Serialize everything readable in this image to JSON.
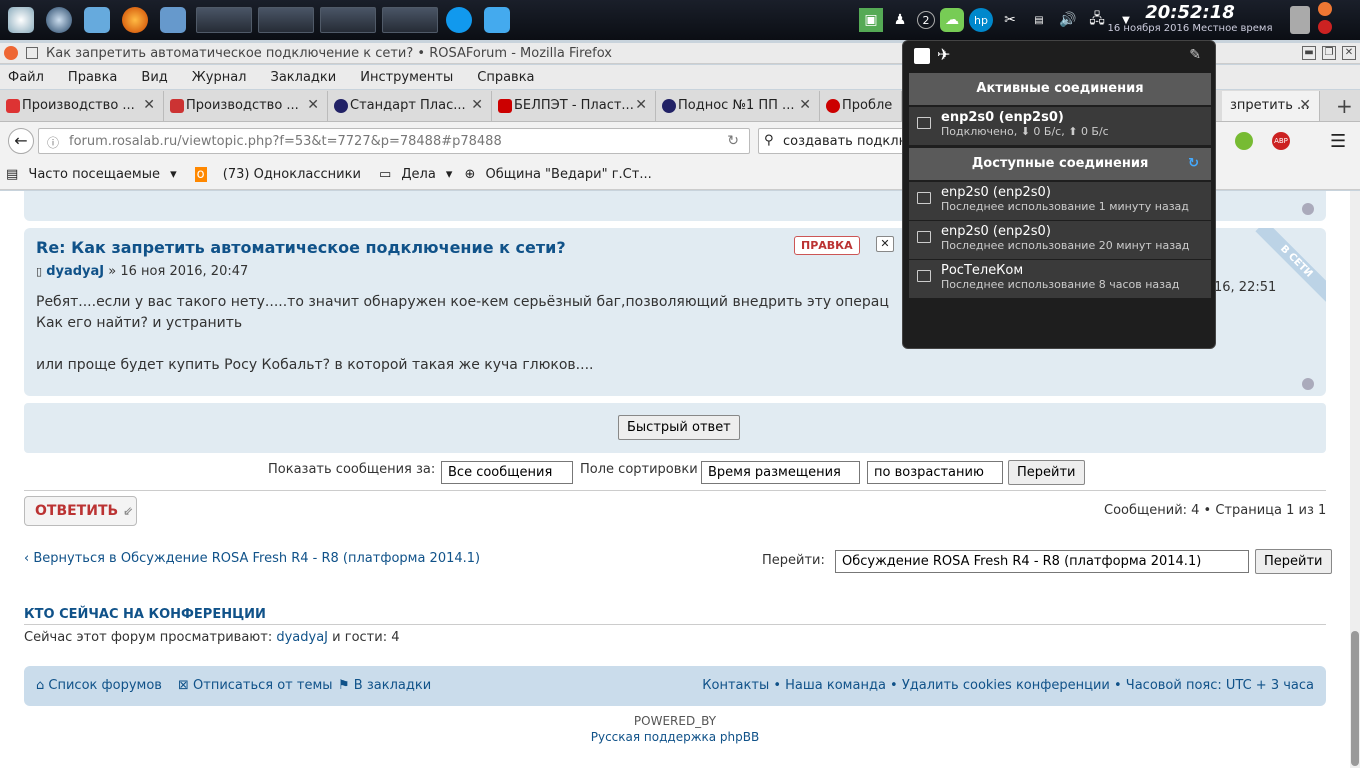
{
  "panel": {
    "time": "20:52:18",
    "date": "16 ноября 2016 Местное время",
    "tray_badge": "2"
  },
  "window": {
    "title": "Как запретить автоматическое подключение к сети? • ROSAForum - Mozilla Firefox"
  },
  "menu": [
    "Файл",
    "Правка",
    "Вид",
    "Журнал",
    "Закладки",
    "Инструменты",
    "Справка"
  ],
  "tabs": [
    {
      "label": "Производство ...",
      "color": "#d33"
    },
    {
      "label": "Производство ...",
      "color": "#c33"
    },
    {
      "label": "Стандарт Плас...",
      "color": "#226"
    },
    {
      "label": "БЕЛПЭТ - Пласт...",
      "color": "#c00"
    },
    {
      "label": "Поднос №1 ПП ...",
      "color": "#226"
    },
    {
      "label": "Пробле",
      "color": "#c00"
    },
    {
      "label": "зпретить ...",
      "color": "#888"
    }
  ],
  "nav": {
    "url": "forum.rosalab.ru/viewtopic.php?f=53&t=7727&p=78488#p78488",
    "search": "создавать подключ"
  },
  "bookmarks": [
    "Часто посещаемые",
    "(73) Одноклассники",
    "Дела",
    "Община \"Ведари\" г.Ст..."
  ],
  "post": {
    "title": "Re: Как запретить автоматическое подключение к сети?",
    "author": "dyadyaJ",
    "date": "» 16 ноя 2016, 20:47",
    "edit": "ПРАВКА",
    "online": "В СЕТИ",
    "side_date": "16, 22:51",
    "body": "Ребят....если у вас такого нету.....то значит обнаружен кое-кем серьёзный баг,позволяющий внедрить эту операц\nКак его найти? и устранить\n\nили проще будет купить Росу Кобальт? в которой такая же куча глюков...."
  },
  "quick_reply": "Быстрый ответ",
  "sort": {
    "show_label": "Показать сообщения за:",
    "show_value": "Все сообщения",
    "sort_label": "Поле сортировки",
    "sort_value": "Время размещения",
    "order_value": "по возрастанию",
    "go": "Перейти"
  },
  "reply_button": "ОТВЕТИТЬ",
  "pagination": "Сообщений: 4 • Страница 1 из 1",
  "back_link": "Вернуться в Обсуждение ROSA Fresh R4 - R8 (платформа 2014.1)",
  "jump": {
    "label": "Перейти:",
    "value": "Обсуждение ROSA Fresh R4 - R8 (платформа 2014.1)",
    "go": "Перейти"
  },
  "online": {
    "heading": "КТО СЕЙЧАС НА КОНФЕРЕНЦИИ",
    "text": "Сейчас этот форум просматривают:",
    "user": "dyadyaJ",
    "guests": "и гости: 4"
  },
  "footer": {
    "forums": "Список форумов",
    "unsub": "Отписаться от темы",
    "bookmark": "В закладки",
    "right": "Контакты • Наша команда • Удалить cookies конференции • Часовой пояс: UTC + 3 часа",
    "powered": "POWERED_BY",
    "support": "Русская поддержка phpBB"
  },
  "network": {
    "active_header": "Активные соединения",
    "active": {
      "name": "enp2s0 (enp2s0)",
      "status": "Подключено, ⬇ 0 Б/с, ⬆ 0 Б/с"
    },
    "available_header": "Доступные соединения",
    "available": [
      {
        "name": "enp2s0 (enp2s0)",
        "status": "Последнее использование 1 минуту назад"
      },
      {
        "name": "enp2s0 (enp2s0)",
        "status": "Последнее использование 20 минут назад"
      },
      {
        "name": "РосТелеКом",
        "status": "Последнее использование 8 часов назад"
      }
    ]
  }
}
